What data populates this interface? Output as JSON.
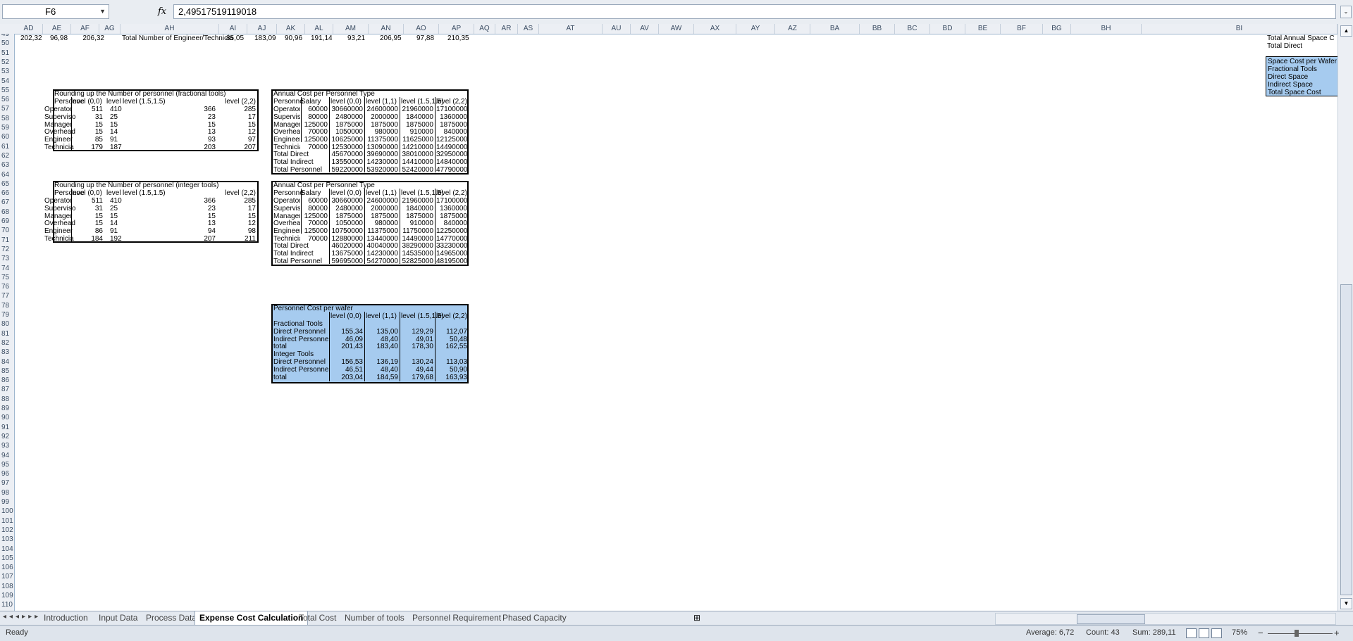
{
  "formula_bar": {
    "name_box": "F6",
    "fx": "fx",
    "formula": "2,49517519119018"
  },
  "columns": [
    "AD",
    "AE",
    "AF",
    "AG",
    "AH",
    "AI",
    "AJ",
    "AK",
    "AL",
    "AM",
    "AN",
    "AO",
    "AP",
    "AQ",
    "AR",
    "AS",
    "AT",
    "AU",
    "AV",
    "AW",
    "AX",
    "AY",
    "AZ",
    "BA",
    "BB",
    "BC",
    "BD",
    "BE",
    "BF",
    "BG",
    "BH",
    "BI"
  ],
  "rows": [
    "49",
    "50",
    "51",
    "52",
    "53",
    "54",
    "55",
    "56",
    "57",
    "58",
    "59",
    "60",
    "61",
    "62",
    "63",
    "64",
    "65",
    "66",
    "67",
    "68",
    "69",
    "70",
    "71",
    "72",
    "73",
    "74",
    "75",
    "76",
    "77",
    "78",
    "79",
    "80",
    "81",
    "82",
    "83",
    "84",
    "85",
    "86",
    "87",
    "88",
    "89",
    "90",
    "91",
    "92",
    "93",
    "94",
    "95",
    "96",
    "97",
    "98",
    "99",
    "100",
    "101",
    "102",
    "103",
    "104",
    "105",
    "106",
    "107",
    "108",
    "109",
    "110"
  ],
  "row50": {
    "ad": "202,32",
    "ae": "96,98",
    "af": "206,32",
    "ah": "Total Number of Engineer/Technicia",
    "ai": "85,05",
    "aj": "183,09",
    "ak": "90,96",
    "al": "191,14",
    "am": "93,21",
    "an": "206,95",
    "ao": "97,88",
    "ap": "210,35"
  },
  "bi_labels": {
    "r50": "Total Annual Space C",
    "r51": "Total Direct"
  },
  "bi_box": [
    "Space Cost per Wafer",
    "Fractional Tools",
    "Direct Space",
    "Indirect Space",
    "Total Space Cost"
  ],
  "t1": {
    "title": "Rounding up the Number of personnel (fractional tools)",
    "headers": [
      "Personne",
      "level (0,0)",
      "level",
      "level (1.5,1.5)",
      "level (2,2)"
    ],
    "rows": [
      [
        "Operator",
        "511",
        "410",
        "366",
        "285"
      ],
      [
        "Superviso",
        "31",
        "25",
        "23",
        "17"
      ],
      [
        "Manager",
        "15",
        "15",
        "15",
        "15"
      ],
      [
        "Overhead",
        "15",
        "14",
        "13",
        "12"
      ],
      [
        "Engineer",
        "85",
        "91",
        "93",
        "97"
      ],
      [
        "Technicia",
        "179",
        "187",
        "203",
        "207"
      ]
    ]
  },
  "t2": {
    "title": "Rounding up the Number of personnel (integer tools)",
    "headers": [
      "Personne",
      "level (0,0)",
      "level",
      "level (1.5,1.5)",
      "level (2,2)"
    ],
    "rows": [
      [
        "Operator",
        "511",
        "410",
        "366",
        "285"
      ],
      [
        "Superviso",
        "31",
        "25",
        "23",
        "17"
      ],
      [
        "Manager",
        "15",
        "15",
        "15",
        "15"
      ],
      [
        "Overhead",
        "15",
        "14",
        "13",
        "12"
      ],
      [
        "Engineer",
        "86",
        "91",
        "94",
        "98"
      ],
      [
        "Technicia",
        "184",
        "192",
        "207",
        "211"
      ]
    ]
  },
  "t3": {
    "title": "Annual Cost per Personnel Type",
    "headers": [
      "Personne",
      "Salary",
      "level (0,0)",
      "level (1,1)",
      "level (1.5,1.5)",
      "level (2,2)"
    ],
    "rows": [
      [
        "Operator",
        "60000",
        "30660000",
        "24600000",
        "21960000",
        "17100000"
      ],
      [
        "Superviso",
        "80000",
        "2480000",
        "2000000",
        "1840000",
        "1360000"
      ],
      [
        "Manager",
        "125000",
        "1875000",
        "1875000",
        "1875000",
        "1875000"
      ],
      [
        "Overhead",
        "70000",
        "1050000",
        "980000",
        "910000",
        "840000"
      ],
      [
        "Engineer",
        "125000",
        "10625000",
        "11375000",
        "11625000",
        "12125000"
      ],
      [
        "Technicia",
        "70000",
        "12530000",
        "13090000",
        "14210000",
        "14490000"
      ]
    ],
    "totals": [
      [
        "Total Direct",
        "45670000",
        "39690000",
        "38010000",
        "32950000"
      ],
      [
        "Total Indirect",
        "13550000",
        "14230000",
        "14410000",
        "14840000"
      ],
      [
        "Total Personnel",
        "59220000",
        "53920000",
        "52420000",
        "47790000"
      ]
    ]
  },
  "t4": {
    "title": "Annual Cost per Personnel Type",
    "headers": [
      "Personne",
      "Salary",
      "level (0,0)",
      "level (1,1)",
      "level (1.5,1.5)",
      "level (2,2)"
    ],
    "rows": [
      [
        "Operator",
        "60000",
        "30660000",
        "24600000",
        "21960000",
        "17100000"
      ],
      [
        "Superviso",
        "80000",
        "2480000",
        "2000000",
        "1840000",
        "1360000"
      ],
      [
        "Manager",
        "125000",
        "1875000",
        "1875000",
        "1875000",
        "1875000"
      ],
      [
        "Overhead",
        "70000",
        "1050000",
        "980000",
        "910000",
        "840000"
      ],
      [
        "Engineer",
        "125000",
        "10750000",
        "11375000",
        "11750000",
        "12250000"
      ],
      [
        "Technicia",
        "70000",
        "12880000",
        "13440000",
        "14490000",
        "14770000"
      ]
    ],
    "totals": [
      [
        "Total Direct",
        "46020000",
        "40040000",
        "38290000",
        "33230000"
      ],
      [
        "Total Indirect",
        "13675000",
        "14230000",
        "14535000",
        "14965000"
      ],
      [
        "Total Personnel",
        "59695000",
        "54270000",
        "52825000",
        "48195000"
      ]
    ]
  },
  "t5": {
    "title": "Personnel Cost per wafer",
    "headers": [
      "level (0,0)",
      "level (1,1)",
      "level (1.5,1.5)",
      "level (2,2)"
    ],
    "rows": [
      [
        "Fractional Tools",
        "",
        "",
        "",
        ""
      ],
      [
        "Direct Personnel",
        "155,34",
        "135,00",
        "129,29",
        "112,07"
      ],
      [
        "Indirect Personnel",
        "46,09",
        "48,40",
        "49,01",
        "50,48"
      ],
      [
        "total",
        "201,43",
        "183,40",
        "178,30",
        "162,55"
      ],
      [
        "Integer Tools",
        "",
        "",
        "",
        ""
      ],
      [
        "Direct Personnel",
        "156,53",
        "136,19",
        "130,24",
        "113,03"
      ],
      [
        "Indirect Personnel",
        "46,51",
        "48,40",
        "49,44",
        "50,90"
      ],
      [
        "total",
        "203,04",
        "184,59",
        "179,68",
        "163,93"
      ]
    ]
  },
  "tabs": [
    "Introduction",
    "Input Data",
    "Process Data",
    "Expense Cost Calculation",
    "Total Cost",
    "Number of tools",
    "Personnel Requirement",
    "Phased Capacity"
  ],
  "status": {
    "ready": "Ready",
    "average": "Average: 6,72",
    "count": "Count: 43",
    "sum": "Sum: 289,11",
    "zoom": "75%"
  }
}
